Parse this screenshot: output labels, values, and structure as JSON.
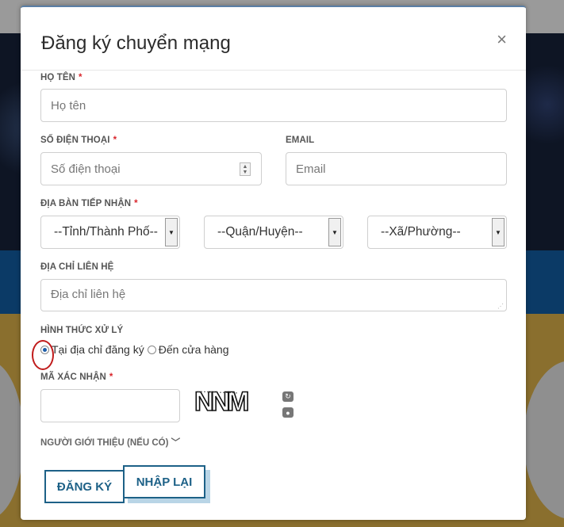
{
  "modal": {
    "title": "Đăng ký chuyển mạng",
    "close_glyph": "×"
  },
  "form": {
    "name": {
      "label": "HỌ TÊN",
      "required": "*",
      "placeholder": "Họ tên",
      "value": ""
    },
    "phone": {
      "label": "SỐ ĐIỆN THOẠI",
      "required": "*",
      "placeholder": "Số điện thoại",
      "value": ""
    },
    "email": {
      "label": "EMAIL",
      "placeholder": "Email",
      "value": ""
    },
    "area": {
      "label": "ĐỊA BÀN TIẾP NHẬN",
      "required": "*",
      "province": "--Tỉnh/Thành Phố--",
      "district": "--Quận/Huyện--",
      "ward": "--Xã/Phường--"
    },
    "address": {
      "label": "ĐỊA CHỈ LIÊN HỆ",
      "placeholder": "Địa chỉ liên hệ"
    },
    "processing": {
      "label": "HÌNH THỨC XỬ LÝ",
      "options": [
        "Tại địa chỉ đăng ký",
        "Đến cửa hàng"
      ],
      "selected": "Tại địa chỉ đăng ký"
    },
    "captcha": {
      "label": "MÃ XÁC NHẬN",
      "required": "*",
      "value": "",
      "image_text": "NNM"
    },
    "referral": {
      "label": "NGƯỜI GIỚI THIỆU (NẾU CÓ)",
      "icon": "double-chevron-down-icon"
    }
  },
  "buttons": {
    "register": "ĐĂNG KÝ",
    "reset": "NHẬP LẠI"
  },
  "colors": {
    "button_border": "#1d6187",
    "required_mark": "#d9262c",
    "highlight_ring": "#c01b1b"
  }
}
